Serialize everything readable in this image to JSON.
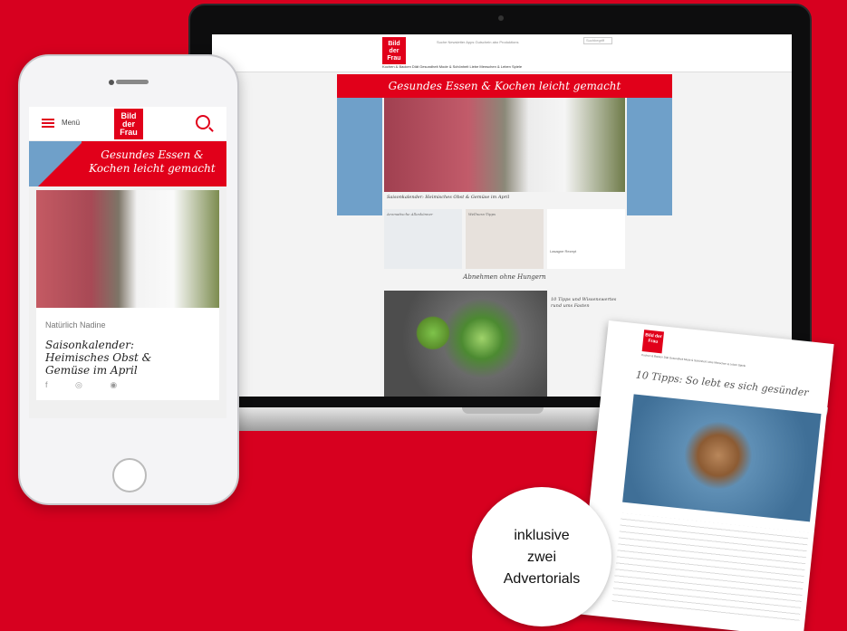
{
  "laptop": {
    "logo": "Bild der Frau",
    "top_nav": "Suche  Newsletter  Apps  Gutschein  abo  Produktions",
    "search_placeholder": "Suchbegriff",
    "main_nav": "Kochen & Backen   Diät   Gesundheit   Mode & Schönheit   Liebe   Menschen & Leben   Spiele",
    "banner": "Gesundes Essen & Kochen leicht gemacht",
    "hero_caption": "Saisonkalender: Heimisches Obst & Gemüse im April",
    "cards": [
      {
        "label": "Aromatische Alleskönner"
      },
      {
        "label": "Wellness-Tipps"
      },
      {
        "label": "Lasagne Rezept"
      }
    ],
    "section": "Abnehmen ohne Hungern",
    "side_article": "10 Tipps und Wissenswertes rund ums Fasten"
  },
  "phone": {
    "menu": "Menü",
    "logo": "Bild der Frau",
    "banner": "Gesundes Essen & Kochen leicht gemacht",
    "kicker": "Natürlich Nadine",
    "title": "Saisonkalender: Heimisches Obst & Gemüse im April",
    "social": "f ◎ ◉"
  },
  "print": {
    "logo": "Bild der Frau",
    "nav": "Kochen & Backen  Diät  Gesundheit  Mode & Schönheit  Liebe  Menschen & Leben  Spiele",
    "title": "10 Tipps: So lebt es sich gesünder"
  },
  "badge": {
    "line1": "inklusive",
    "line2": "zwei",
    "line3": "Advertorials"
  },
  "colors": {
    "brand_red": "#e1001a",
    "background_red": "#d7001f"
  }
}
